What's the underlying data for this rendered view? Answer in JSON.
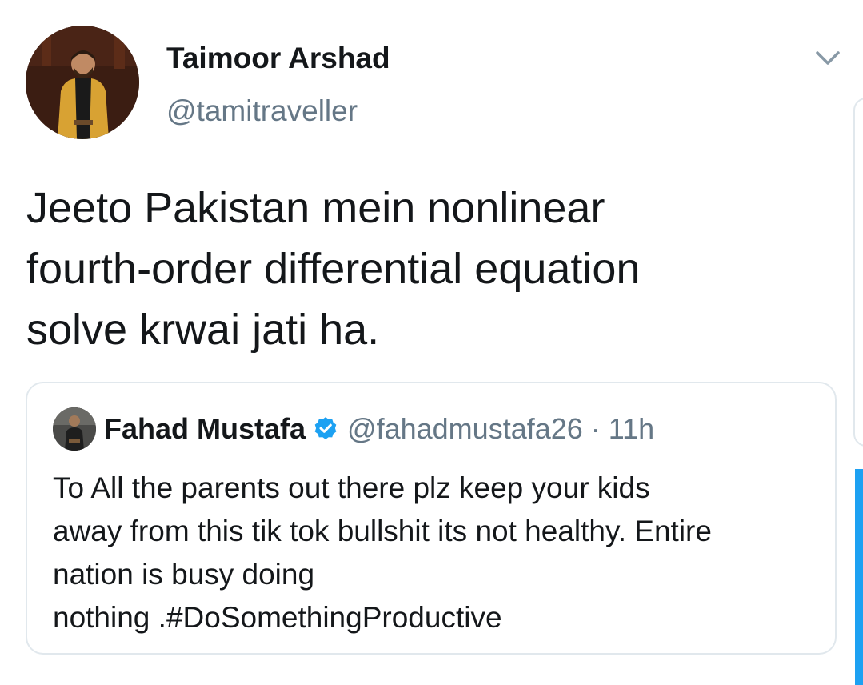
{
  "tweet": {
    "author_name": "Taimoor Arshad",
    "author_handle": "@tamitraveller",
    "text": "Jeeto Pakistan mein nonlinear\nfourth-order differential equation\nsolve krwai jati ha.",
    "menu_icon": "chevron-down-icon"
  },
  "quoted_tweet": {
    "author_name": "Fahad Mustafa",
    "verified_icon": "verified-badge-icon",
    "author_handle": "@fahadmustafa26",
    "separator": "·",
    "time": "11h",
    "text": "To All the parents out there plz keep your kids\naway from this tik tok bullshit its not healthy. Entire\nnation is busy doing\nnothing .#DoSomethingProductive"
  },
  "colors": {
    "text_primary": "#14171a",
    "text_secondary": "#657786",
    "accent": "#1da1f2",
    "border": "#e1e8ed"
  }
}
